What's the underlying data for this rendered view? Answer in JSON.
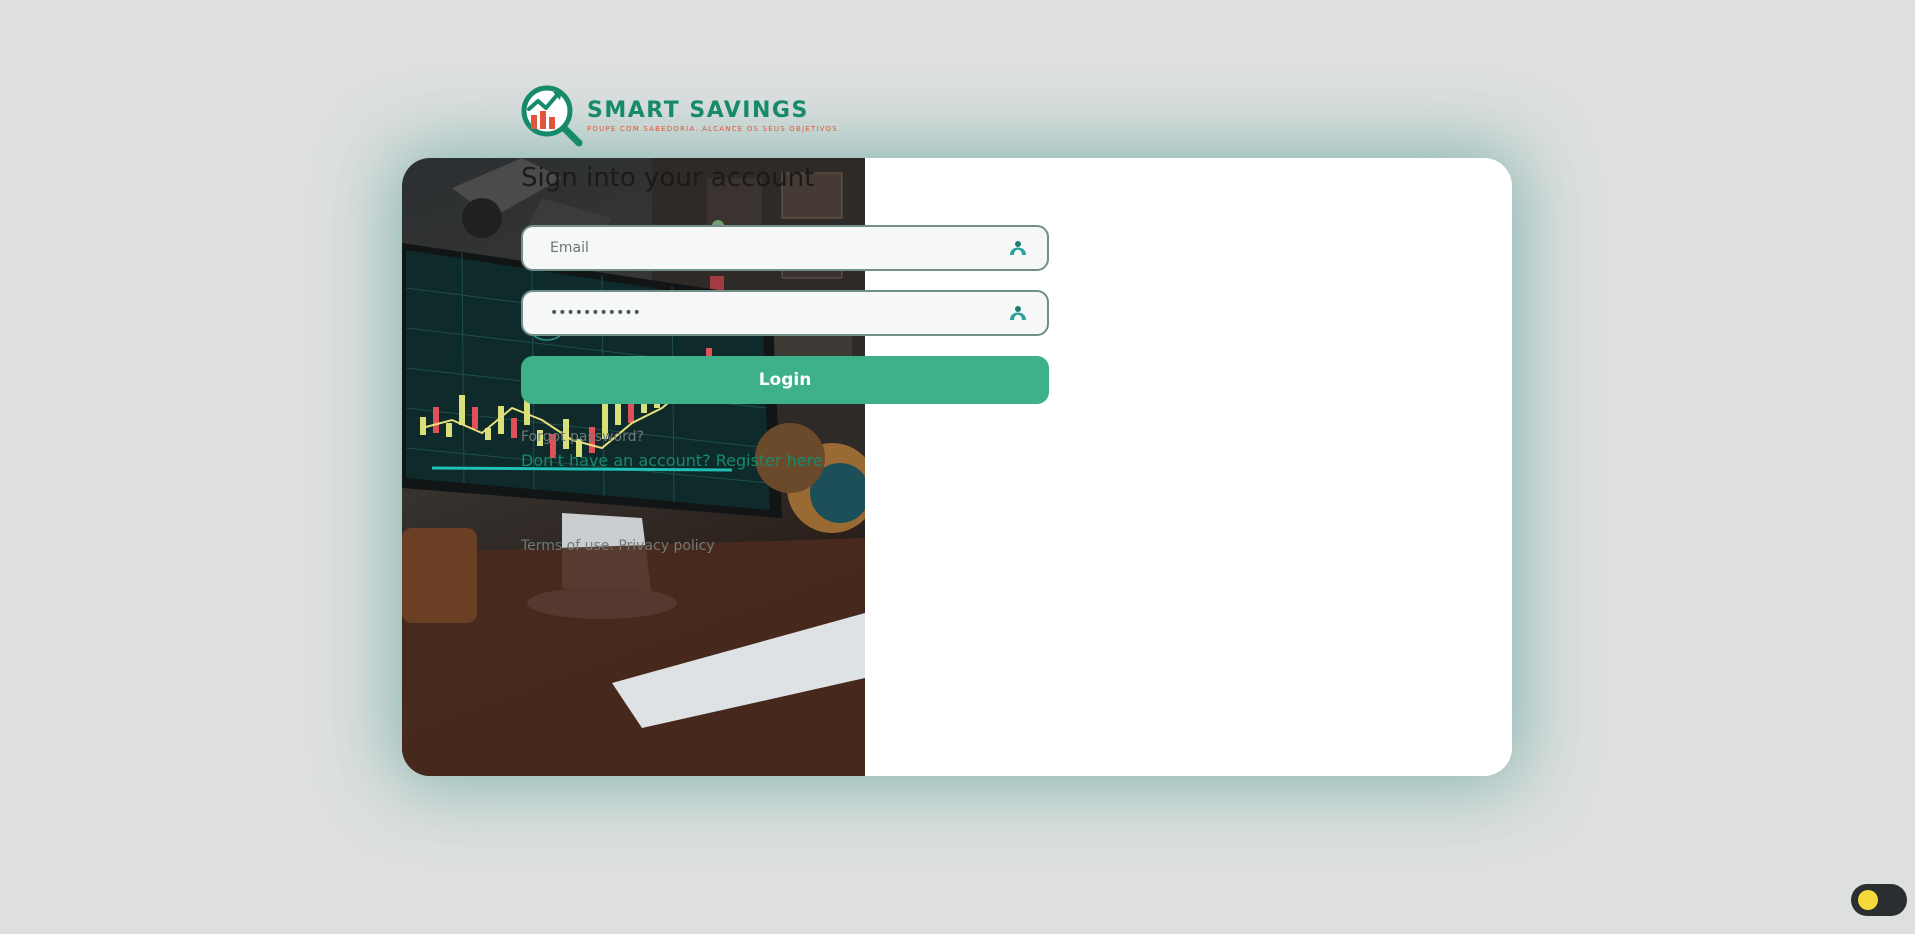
{
  "brand": {
    "name": "SMART SAVINGS",
    "tagline": "POUPE COM SABEDORIA. ALCANCE OS SEUS OBJETIVOS",
    "primary_color": "#168a6b",
    "accent_color": "#e2553a"
  },
  "illustration": {
    "icon": "trading-desk-photo"
  },
  "form": {
    "heading": "Sign into your account",
    "email": {
      "placeholder": "Email",
      "value": "",
      "icon": "user-icon"
    },
    "password": {
      "placeholder": "",
      "value": "***********",
      "icon": "lock-icon"
    },
    "login_label": "Login",
    "login_color": "#3eb08a",
    "forgot_label": "Forgot password?",
    "register_label": "Don't have an account? Register here"
  },
  "footer": {
    "terms_label": "Terms of use.",
    "privacy_label": "Privacy policy"
  },
  "theme_toggle": {
    "icon": "sun-icon",
    "state": "light"
  }
}
